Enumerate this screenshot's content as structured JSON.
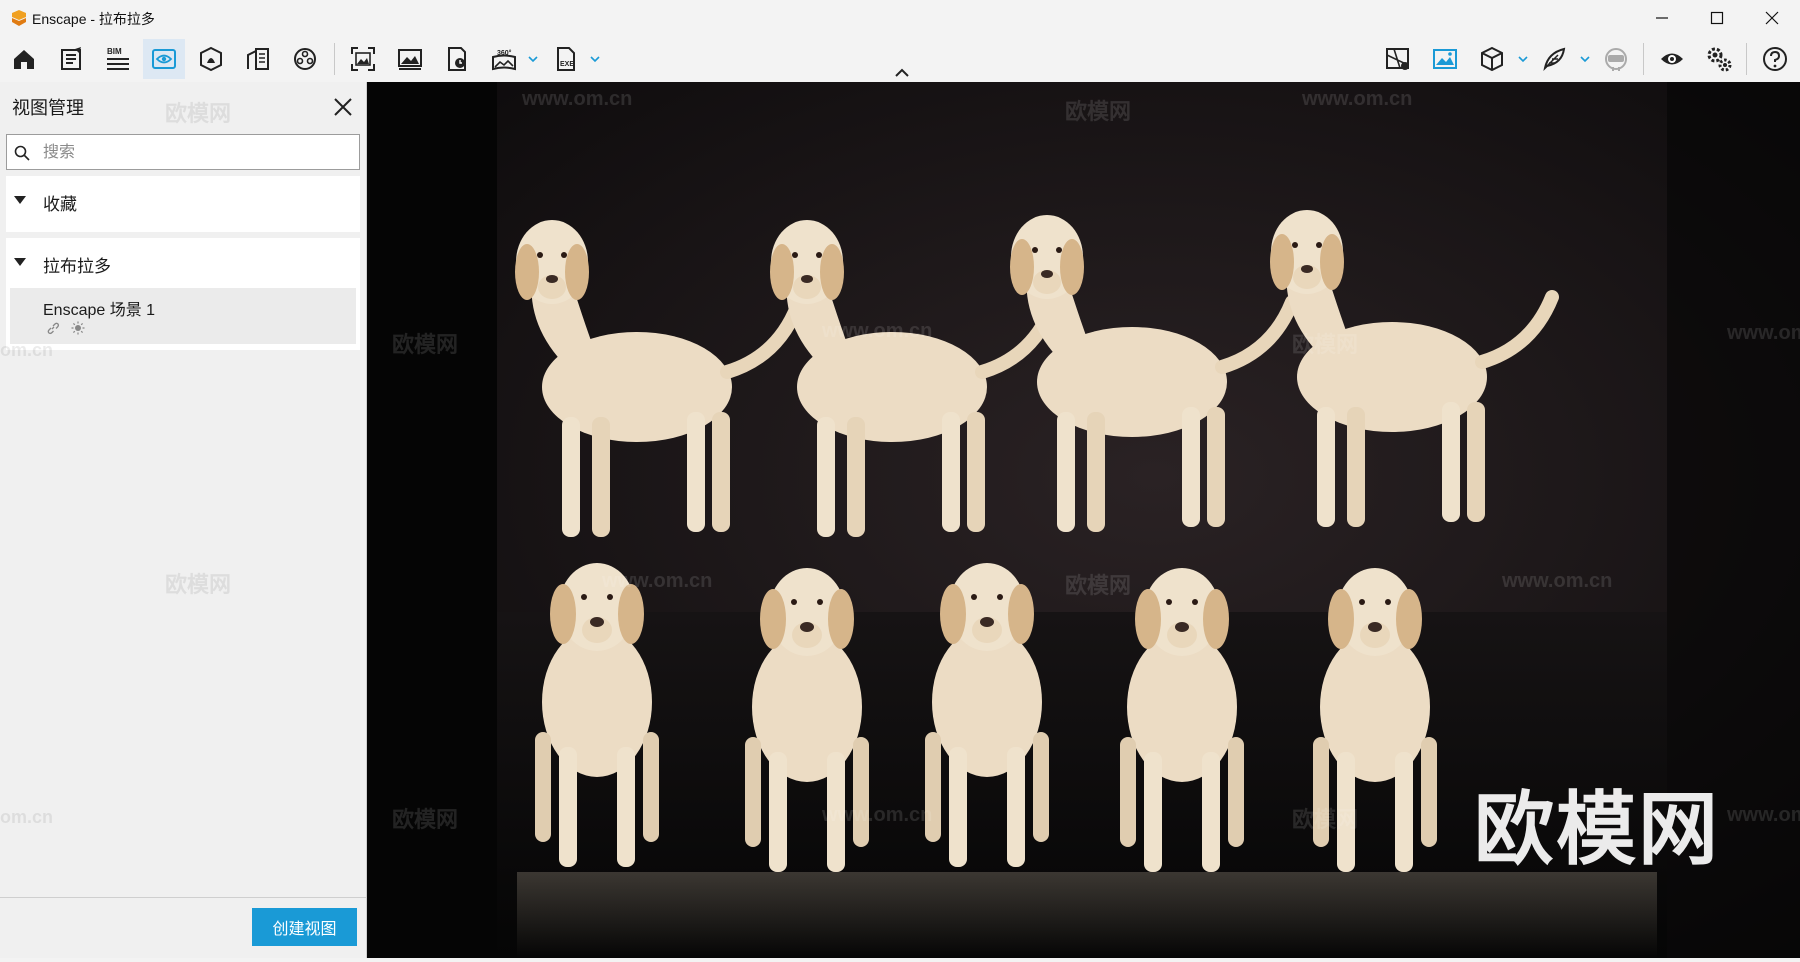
{
  "window": {
    "title": "Enscape - 拉布拉多",
    "logo": "enscape-logo"
  },
  "toolbar": {
    "left_icons": [
      "home-icon",
      "notes-icon",
      "bim-icon",
      "view-management-icon",
      "asset-library-icon",
      "building-icon",
      "material-icon",
      "screenshot-icon",
      "image-export-icon",
      "batch-render-icon",
      "panorama-360-icon",
      "exe-export-icon"
    ],
    "right_icons": [
      "map-icon",
      "visual-settings-icon",
      "cube-icon",
      "feather-icon",
      "vr-headset-icon",
      "eye-icon",
      "settings-icon",
      "help-icon"
    ],
    "bim_label": "BIM",
    "pano_label": "360°",
    "exe_label": "EXE"
  },
  "panel": {
    "title": "视图管理",
    "search_placeholder": "搜索",
    "favorites_label": "收藏",
    "group_label": "拉布拉多",
    "views": [
      {
        "name": "Enscape 场景 1"
      }
    ],
    "create_button": "创建视图"
  },
  "viewport": {
    "watermark_text": "欧模网",
    "watermark_url": "www.om.cn",
    "watermark_url_fragment": "om.cn",
    "big_watermark": "欧模网"
  },
  "colors": {
    "accent": "#1a9ad6",
    "active_tab": "#dde8f3",
    "fur": "#ecdcc4"
  }
}
